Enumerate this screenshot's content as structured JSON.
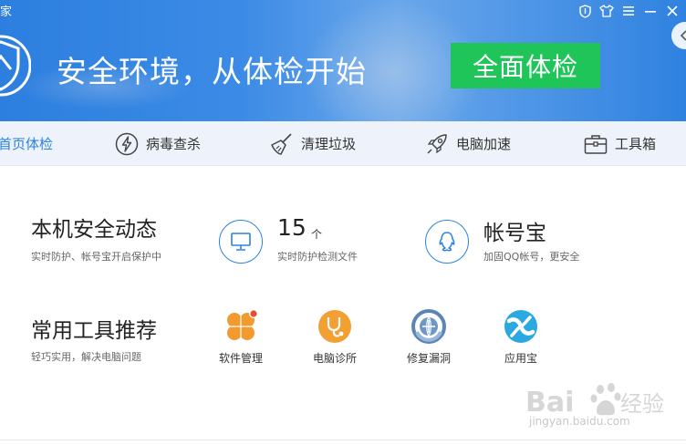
{
  "window": {
    "title": "家",
    "controls": [
      "shield-icon",
      "shirt-icon",
      "menu-icon",
      "minimize-icon",
      "close-icon"
    ]
  },
  "header": {
    "slogan": "安全环境，从体检开始",
    "scan_button": "全面体检",
    "colors": {
      "banner": "#2d7fdf",
      "scan_button": "#1fc558"
    }
  },
  "nav": {
    "items": [
      {
        "label": "首页体检",
        "icon": "",
        "active": true
      },
      {
        "label": "病毒查杀",
        "icon": "lightning-circle-icon",
        "active": false
      },
      {
        "label": "清理垃圾",
        "icon": "broom-icon",
        "active": false
      },
      {
        "label": "电脑加速",
        "icon": "rocket-icon",
        "active": false
      },
      {
        "label": "工具箱",
        "icon": "toolbox-icon",
        "active": false
      }
    ],
    "colors": {
      "active": "#2a82e4"
    }
  },
  "security": {
    "title": "本机安全动态",
    "subtitle": "实时防护、帐号宝开启保护中",
    "files_count": "15",
    "files_unit": "个",
    "files_label": "实时防护检测文件",
    "account_title": "帐号宝",
    "account_label": "加固QQ帐号，更安全"
  },
  "tools": {
    "title": "常用工具推荐",
    "subtitle": "轻巧实用，解决电脑问题",
    "items": [
      {
        "label": "软件管理",
        "icon": "software-manager-icon"
      },
      {
        "label": "电脑诊所",
        "icon": "computer-clinic-icon"
      },
      {
        "label": "修复漏洞",
        "icon": "repair-vulnerability-icon"
      },
      {
        "label": "应用宝",
        "icon": "app-store-icon"
      }
    ]
  },
  "watermark": {
    "brand": "Bai 经验",
    "url": "jingyan.baidu.com"
  }
}
